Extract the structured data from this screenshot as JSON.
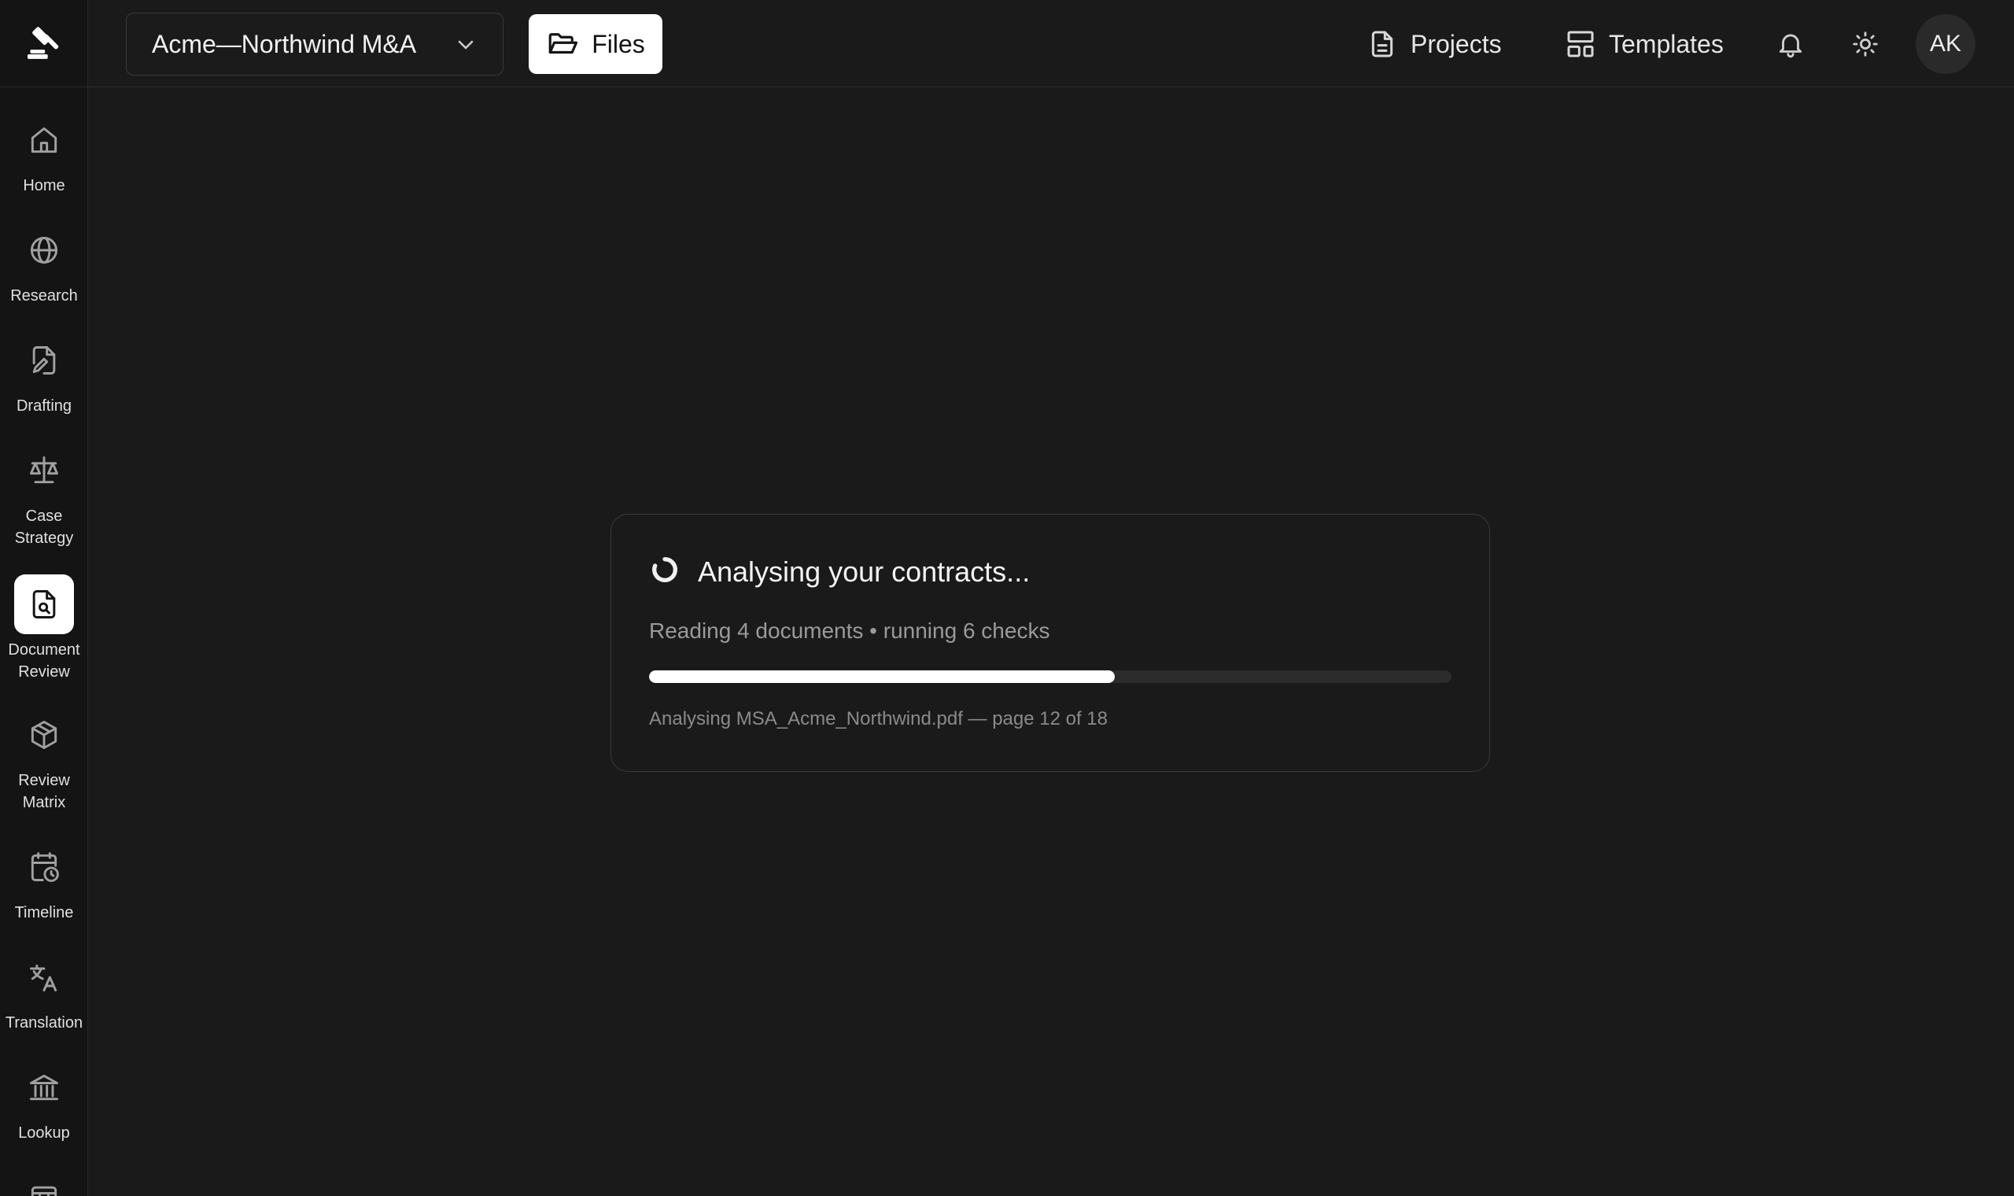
{
  "project": {
    "name": "Acme—Northwind M&A"
  },
  "toolbar": {
    "files_label": "Files"
  },
  "header": {
    "projects_label": "Projects",
    "templates_label": "Templates",
    "avatar_initials": "AK"
  },
  "sidebar": {
    "items": [
      {
        "label": "Home",
        "icon": "home-icon"
      },
      {
        "label": "Research",
        "icon": "globe-icon"
      },
      {
        "label": "Drafting",
        "icon": "document-edit-icon"
      },
      {
        "label": "Case\nStrategy",
        "icon": "scales-icon"
      },
      {
        "label": "Document\nReview",
        "icon": "document-search-icon",
        "active": true
      },
      {
        "label": "Review\nMatrix",
        "icon": "cube-icon"
      },
      {
        "label": "Timeline",
        "icon": "calendar-clock-icon"
      },
      {
        "label": "Translation",
        "icon": "translate-icon"
      },
      {
        "label": "Lookup",
        "icon": "bank-icon"
      }
    ]
  },
  "progress": {
    "title": "Analysing your contracts...",
    "subtitle": "Reading 4 documents • running 6 checks",
    "detail": "Analysing MSA_Acme_Northwind.pdf — page 12 of 18",
    "fraction": 0.58
  },
  "colors": {
    "background": "#1a1a1a",
    "sidebar": "#141414",
    "accent": "#ffffff",
    "muted_text": "#9a9a9a"
  }
}
